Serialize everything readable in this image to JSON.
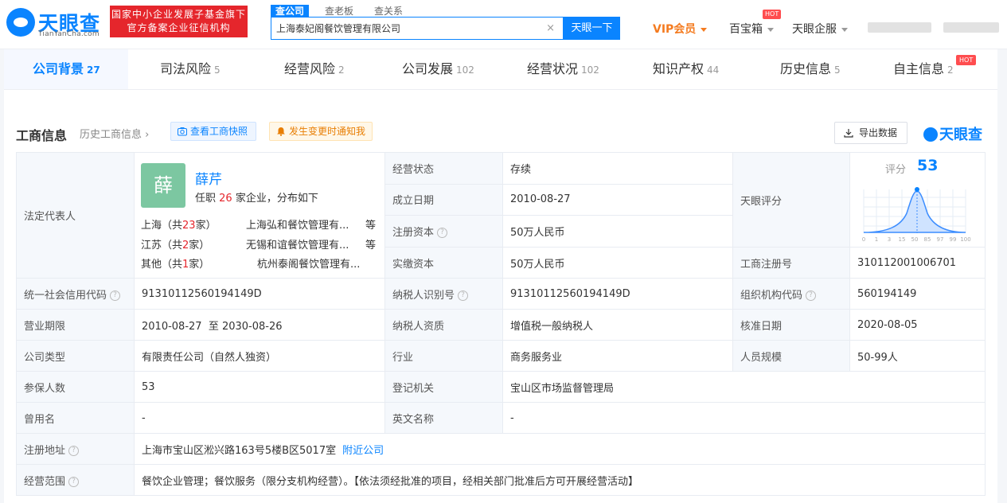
{
  "header": {
    "logo_text": "天眼查",
    "logo_sub": "TianYanCha.com",
    "banner_line1": "国家中小企业发展子基金旗下",
    "banner_line2": "官方备案企业征信机构",
    "search_tabs": [
      "查公司",
      "查老板",
      "查关系"
    ],
    "search_value": "上海泰妃阁餐饮管理有限公司",
    "search_button": "天眼一下",
    "vip_label": "VIP会员",
    "baobao_label": "百宝箱",
    "hot_badge": "HOT",
    "qifu_label": "天眼企服"
  },
  "tabs": [
    {
      "label": "公司背景",
      "count": "27"
    },
    {
      "label": "司法风险",
      "count": "5"
    },
    {
      "label": "经营风险",
      "count": "2"
    },
    {
      "label": "公司发展",
      "count": "102"
    },
    {
      "label": "经营状况",
      "count": "102"
    },
    {
      "label": "知识产权",
      "count": "44"
    },
    {
      "label": "历史信息",
      "count": "5"
    },
    {
      "label": "自主信息",
      "count": "2"
    }
  ],
  "tab_hot": "HOT",
  "section": {
    "title": "工商信息",
    "history_link": "历史工商信息",
    "snapshot_button": "查看工商快照",
    "notify_button": "发生变更时通知我",
    "export_button": "导出数据",
    "brand": "天眼查"
  },
  "rep": {
    "label": "法定代表人",
    "avatar_char": "薛",
    "name": "薛芹",
    "sub_prefix": "任职",
    "sub_count": "26",
    "sub_suffix": "家企业，分布如下",
    "rows": [
      {
        "loc_prefix": "上海（共",
        "count": "23",
        "loc_suffix": "家）",
        "company": "上海弘和餐饮管理有...",
        "etc": "等"
      },
      {
        "loc_prefix": "江苏（共",
        "count": "2",
        "loc_suffix": "家）",
        "company": "无锡和谊餐饮管理有...",
        "etc": "等"
      },
      {
        "loc_prefix": "其他（共",
        "count": "1",
        "loc_suffix": "家）",
        "company": "杭州泰阁餐饮管理有...",
        "etc": ""
      }
    ]
  },
  "fields": {
    "status_k": "经营状态",
    "status_v": "存续",
    "found_k": "成立日期",
    "found_v": "2010-08-27",
    "regcap_k": "注册资本",
    "regcap_v": "50万人民币",
    "paidcap_k": "实缴资本",
    "paidcap_v": "50万人民币",
    "tyscore_k": "天眼评分",
    "score_label": "评分",
    "score_value": "53",
    "regno_k": "工商注册号",
    "regno_v": "310112001006701",
    "uscc_k": "统一社会信用代码",
    "uscc_v": "91310112560194149D",
    "taxid_k": "纳税人识别号",
    "taxid_v": "91310112560194149D",
    "orgcode_k": "组织机构代码",
    "orgcode_v": "560194149",
    "term_k": "营业期限",
    "term_v": "2010-08-27  至 2030-08-26",
    "taxq_k": "纳税人资质",
    "taxq_v": "增值税一般纳税人",
    "approve_k": "核准日期",
    "approve_v": "2020-08-05",
    "type_k": "公司类型",
    "type_v": "有限责任公司（自然人独资）",
    "industry_k": "行业",
    "industry_v": "商务服务业",
    "staff_k": "人员规模",
    "staff_v": "50-99人",
    "insured_k": "参保人数",
    "insured_v": "53",
    "authority_k": "登记机关",
    "authority_v": "宝山区市场监督管理局",
    "oldname_k": "曾用名",
    "oldname_v": "-",
    "enname_k": "英文名称",
    "enname_v": "-",
    "addr_k": "注册地址",
    "addr_v": "上海市宝山区淞兴路163号5楼B区5017室",
    "addr_link": "附近公司",
    "scope_k": "经营范围",
    "scope_v": "餐饮企业管理；餐饮服务（限分支机构经营）。【依法须经批准的项目，经相关部门批准后方可开展经营活动】"
  },
  "score_chart": {
    "type": "area",
    "x_ticks": [
      "0",
      "1",
      "3",
      "15",
      "50",
      "85",
      "97",
      "99",
      "100"
    ],
    "marker_value": 53
  },
  "colors": {
    "brand_blue": "#0a84ff",
    "banner_red": "#e5262c",
    "vip_orange": "#f47b20"
  }
}
